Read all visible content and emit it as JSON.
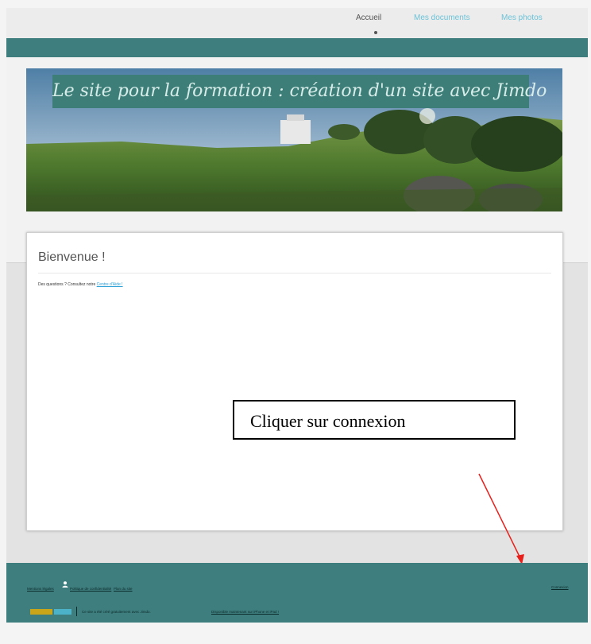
{
  "nav": {
    "items": [
      {
        "label": "Accueil"
      },
      {
        "label": "Mes documents"
      },
      {
        "label": "Mes photos"
      }
    ]
  },
  "banner": {
    "title": "Le site pour la formation : création d'un site avec Jimdo"
  },
  "card": {
    "title": "Bienvenue !",
    "text": "Des questions ? Consultez notre",
    "link": "Centre d'Aide !"
  },
  "callout": {
    "text": "Cliquer sur connexion"
  },
  "footer": {
    "links": {
      "about": "Mentions légales",
      "cancel": "Politique de confidentialité",
      "sitemap": "Plan du site",
      "login": "Connexion"
    },
    "jimdo_text": "Ce site a été créé gratuitement avec Jimdo.",
    "jimdo_link": "Disponible maintenant sur iPhone et iPad !"
  },
  "colors": {
    "teal": "#3f7e7e",
    "accent": "#6cc3d8",
    "arrow": "#e8201c"
  }
}
